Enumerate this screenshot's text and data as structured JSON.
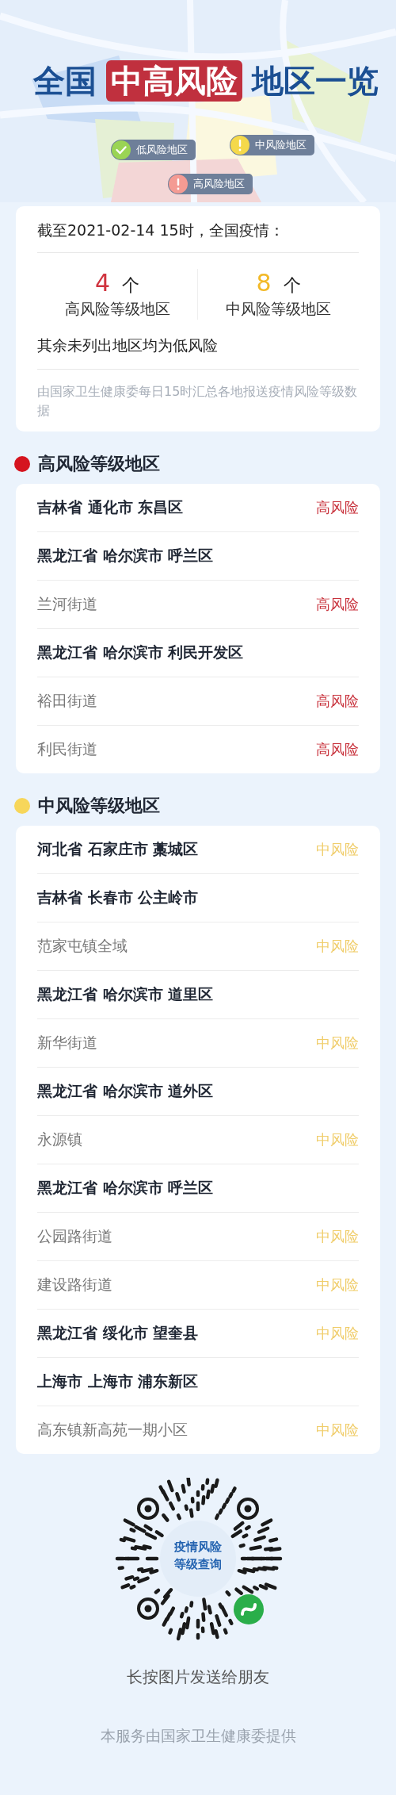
{
  "header": {
    "title_parts": [
      {
        "text": "全国",
        "highlight": false
      },
      {
        "text": "中高风险",
        "highlight": true
      },
      {
        "text": "地区一览",
        "highlight": false
      }
    ],
    "legend": [
      {
        "label": "低风险地区",
        "kind": "check",
        "color": "#9ad454"
      },
      {
        "label": "中风险地区",
        "kind": "alert",
        "color": "#f5d94a"
      },
      {
        "label": "高风险地区",
        "kind": "alert",
        "color": "#f49b93"
      }
    ]
  },
  "summary": {
    "as_of": "截至2021-02-14 15时，全国疫情：",
    "counts": [
      {
        "number": "4",
        "unit": "个",
        "label": "高风险等级地区",
        "color": "#d0343f"
      },
      {
        "number": "8",
        "unit": "个",
        "label": "中风险等级地区",
        "color": "#f2b928"
      }
    ],
    "note": "其余未列出地区均为低风险",
    "source": "由国家卫生健康委每日15时汇总各地报送疫情风险等级数据"
  },
  "sections": [
    {
      "title": "高风险等级地区",
      "color": "#d5141f",
      "rows": [
        {
          "kind": "region",
          "name": "吉林省 通化市 东昌区",
          "tag": "高风险"
        },
        {
          "kind": "region",
          "name": "黑龙江省 哈尔滨市 呼兰区"
        },
        {
          "kind": "place",
          "name": "兰河街道",
          "tag": "高风险"
        },
        {
          "kind": "region",
          "name": "黑龙江省 哈尔滨市 利民开发区"
        },
        {
          "kind": "place",
          "name": "裕田街道",
          "tag": "高风险"
        },
        {
          "kind": "place",
          "name": "利民街道",
          "tag": "高风险"
        }
      ]
    },
    {
      "title": "中风险等级地区",
      "color": "#f7d65a",
      "rows": [
        {
          "kind": "region",
          "name": "河北省 石家庄市 藁城区",
          "tag": "中风险"
        },
        {
          "kind": "region",
          "name": "吉林省 长春市 公主岭市"
        },
        {
          "kind": "place",
          "name": "范家屯镇全域",
          "tag": "中风险"
        },
        {
          "kind": "region",
          "name": "黑龙江省 哈尔滨市 道里区"
        },
        {
          "kind": "place",
          "name": "新华街道",
          "tag": "中风险"
        },
        {
          "kind": "region",
          "name": "黑龙江省 哈尔滨市 道外区"
        },
        {
          "kind": "place",
          "name": "永源镇",
          "tag": "中风险"
        },
        {
          "kind": "region",
          "name": "黑龙江省 哈尔滨市 呼兰区"
        },
        {
          "kind": "place",
          "name": "公园路街道",
          "tag": "中风险"
        },
        {
          "kind": "place",
          "name": "建设路街道",
          "tag": "中风险"
        },
        {
          "kind": "region",
          "name": "黑龙江省 绥化市 望奎县",
          "tag": "中风险"
        },
        {
          "kind": "region",
          "name": "上海市 上海市 浦东新区"
        },
        {
          "kind": "place",
          "name": "高东镇新高苑一期小区",
          "tag": "中风险"
        }
      ]
    }
  ],
  "qr": {
    "label_lines": [
      "疫情风险",
      "等级查询"
    ],
    "caption": "长按图片发送给朋友"
  },
  "footer": "本服务由国家卫生健康委提供"
}
